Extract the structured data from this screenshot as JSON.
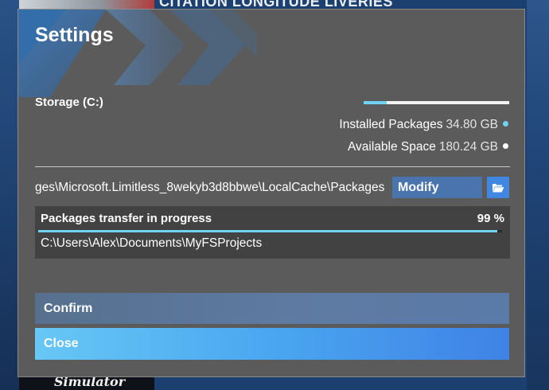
{
  "background": {
    "banner_title": "CITATION LONGITUDE LIVERIES",
    "logo_text": "Simulator"
  },
  "dialog": {
    "title": "Settings",
    "storage": {
      "label": "Storage (C:)",
      "used_fraction": 0.16,
      "installed_label": "Installed Packages",
      "installed_value": "34.80 GB",
      "installed_color": "#6fd3f2",
      "available_label": "Available Space",
      "available_value": "180.24 GB",
      "available_color": "#ffffff"
    },
    "path": {
      "value": "ges\\Microsoft.Limitless_8wekyb3d8bbwe\\LocalCache\\Packages",
      "modify_label": "Modify",
      "folder_icon": "folder-open-icon"
    },
    "transfer": {
      "title": "Packages transfer in progress",
      "percent_text": "99 %",
      "progress": 0.99,
      "destination": "C:\\Users\\Alex\\Documents\\MyFSProjects"
    },
    "buttons": {
      "confirm": "Confirm",
      "close": "Close"
    }
  },
  "colors": {
    "accent": "#6fd3f2",
    "dialog_bg": "#5b5b5b",
    "confirm_bg": "#5e7ba3",
    "close_bg": "#4aa6f0"
  }
}
